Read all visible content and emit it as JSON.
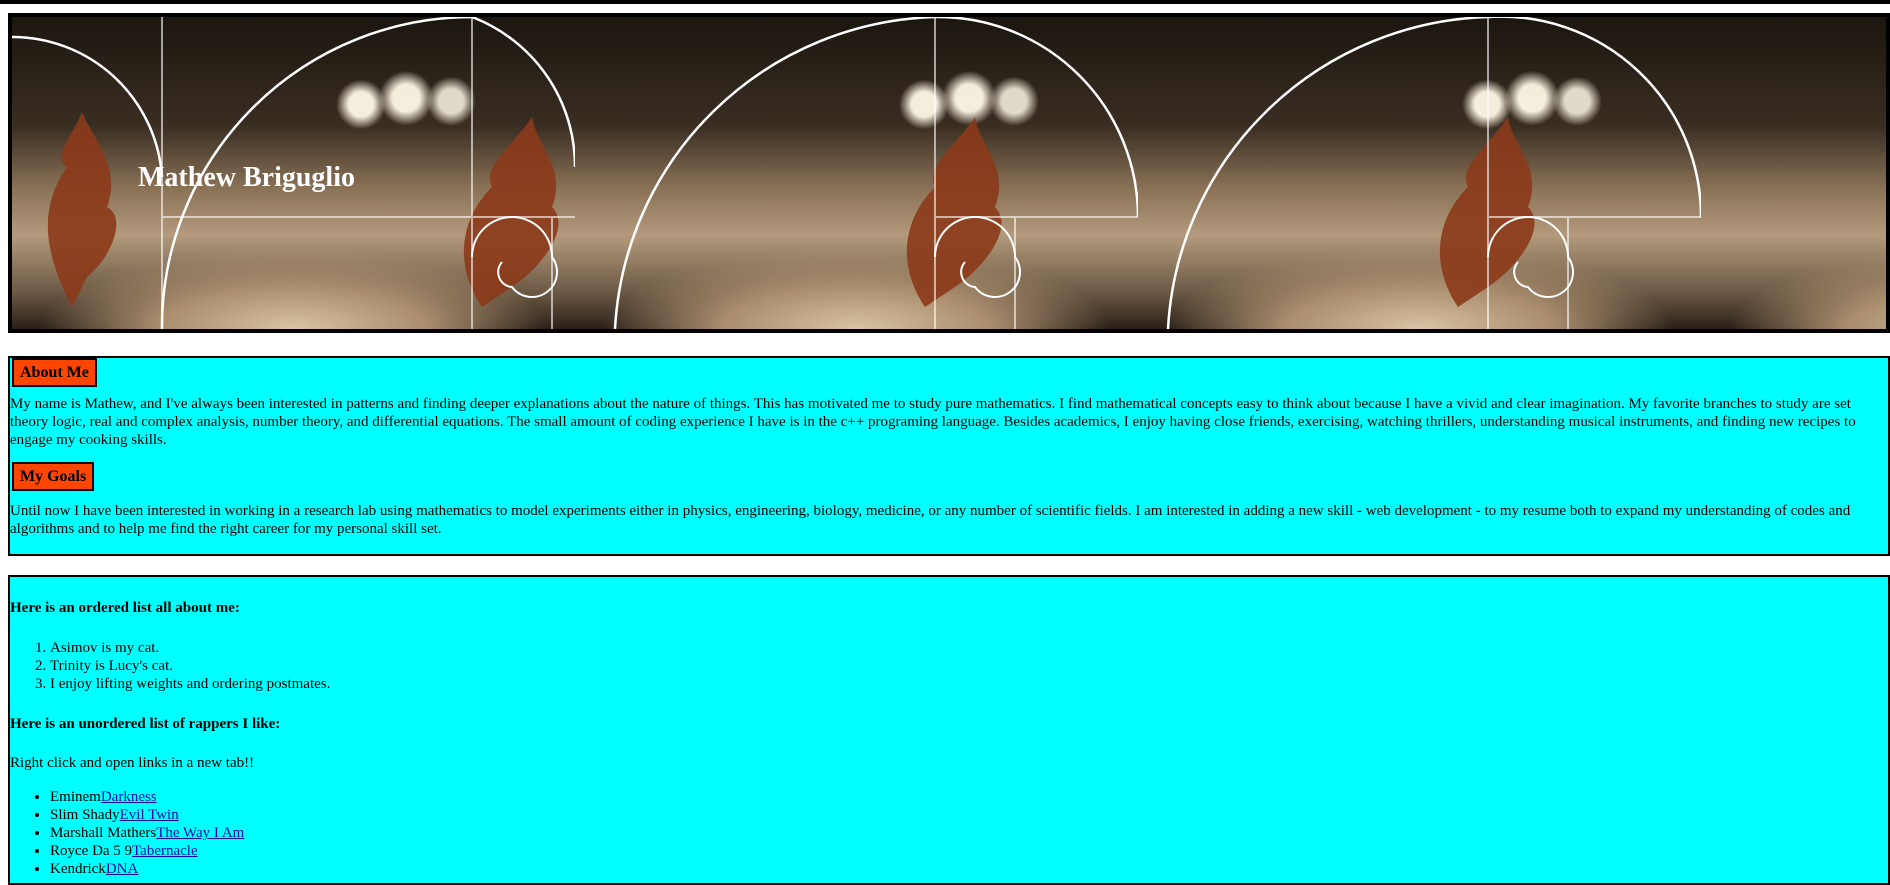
{
  "header": {
    "name": "Mathew Briguglio"
  },
  "about": {
    "heading": "About Me",
    "text": "My name is Mathew, and I've always been interested in patterns and finding deeper explanations about the nature of things. This has motivated me to study pure mathematics. I find mathematical concepts easy to think about because I have a vivid and clear imagination. My favorite branches to study are set theory logic, real and complex analysis, number theory, and differential equations. The small amount of coding experience I have is in the c++ programing language. Besides academics, I enjoy having close friends, exercising, watching thrillers, understanding musical instruments, and finding new recipes to engage my cooking skills."
  },
  "goals": {
    "heading": "My Goals",
    "text": "Until now I have been interested in working in a research lab using mathematics to model experiments either in physics, engineering, biology, medicine, or any number of scientific fields. I am interested in adding a new skill - web development - to my resume both to expand my understanding of codes and algorithms and to help me find the right career for my personal skill set."
  },
  "ordered": {
    "label": "Here is an ordered list all about me:",
    "items": [
      "Asimov is my cat.",
      "Trinity is Lucy's cat.",
      "I enjoy lifting weights and ordering postmates."
    ]
  },
  "rappers": {
    "label": "Here is an unordered list of rappers I like:",
    "note": "Right click and open links in a new tab!!",
    "items": [
      {
        "name": "Eminem",
        "link": "Darkness"
      },
      {
        "name": "Slim Shady",
        "link": "Evil Twin"
      },
      {
        "name": "Marshall Mathers",
        "link": "The Way I Am"
      },
      {
        "name": "Royce Da 5 9",
        "link": "Tabernacle"
      },
      {
        "name": "Kendrick",
        "link": "DNA"
      }
    ]
  },
  "colors": {
    "section_bg": "#00ffff",
    "heading_bg": "#ff4500",
    "link": "#1a0dab"
  }
}
